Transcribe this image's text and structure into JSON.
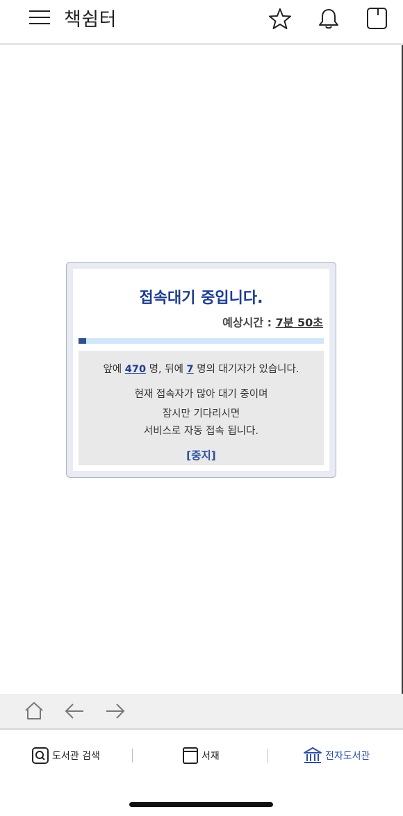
{
  "header": {
    "title": "책쉼터",
    "icons": [
      "menu-icon",
      "star-icon",
      "bell-icon",
      "tabs-icon"
    ]
  },
  "wait": {
    "title": "접속대기 중입니다.",
    "eta_label": "예상시간 : ",
    "eta_value": "7분 50초",
    "progress": 0.03,
    "queue_prefix": "앞에 ",
    "ahead_count": "470",
    "queue_mid": " 명, 뒤에 ",
    "behind_count": "7",
    "queue_suffix": " 명의 대기자가 있습니다.",
    "message_lines": [
      "현재 접속자가 많아 대기 중이며",
      "잠시만 기다리시면",
      "서비스로 자동 접속 됩니다."
    ],
    "stop_label": "[중지]"
  },
  "browser_nav": {
    "icons": [
      "home-icon",
      "back-arrow-icon",
      "forward-arrow-icon"
    ]
  },
  "tabs": {
    "search_label": "도서관 검색",
    "shelf_label": "서재",
    "library_label": "전자도서관"
  },
  "colors": {
    "accent": "#1e3d8f",
    "link": "#2d4fa0",
    "progress_track": "#cfe6fb",
    "progress_fill": "#2f4f8f"
  }
}
